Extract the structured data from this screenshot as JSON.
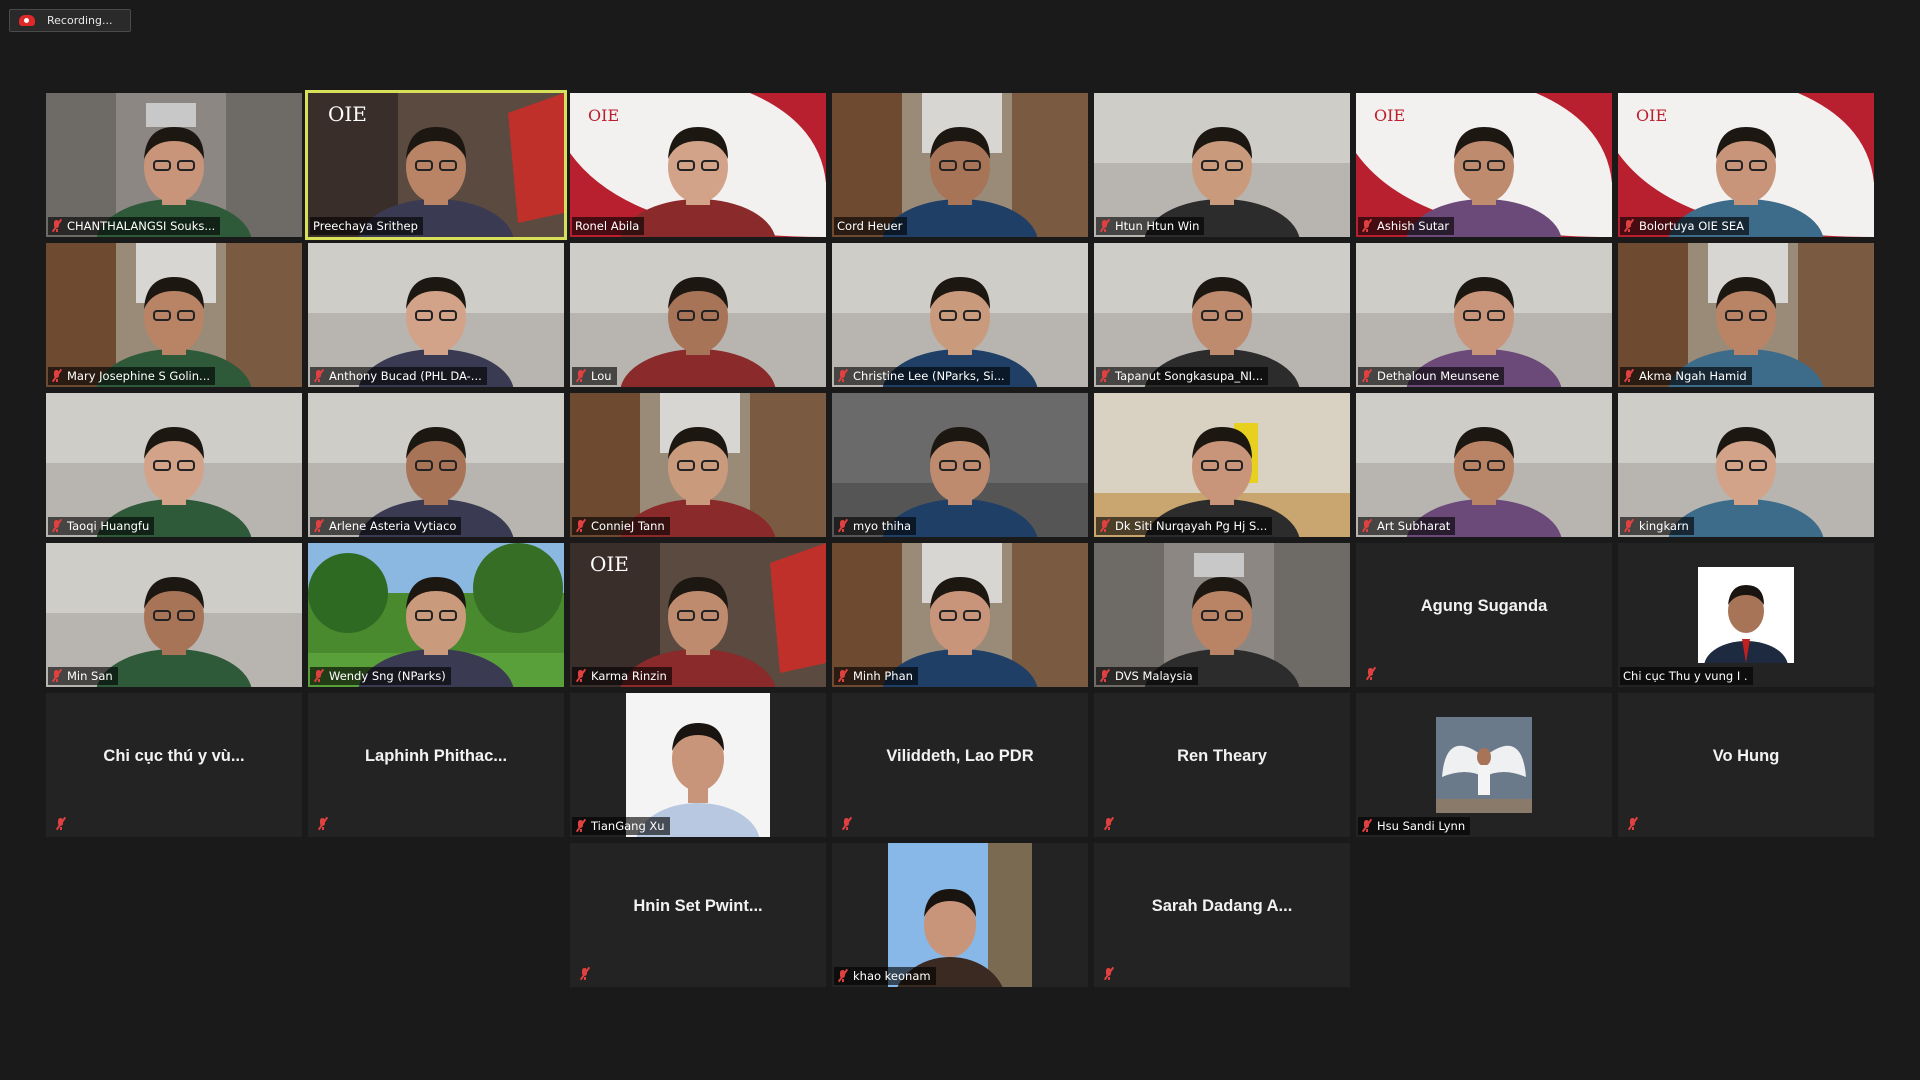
{
  "recording": {
    "label": "Recording..."
  },
  "participants": [
    {
      "name": "CHANTHALANGSI Souks..."
    },
    {
      "name": "Preechaya Srithep"
    },
    {
      "name": "Ronel Abila"
    },
    {
      "name": "Cord Heuer"
    },
    {
      "name": "Htun Htun Win"
    },
    {
      "name": "Ashish Sutar"
    },
    {
      "name": "Bolortuya OIE SEA"
    },
    {
      "name": "Mary Josephine S Golin..."
    },
    {
      "name": "Anthony Bucad (PHL DA-..."
    },
    {
      "name": "Lou"
    },
    {
      "name": "Christine Lee (NParks, Si..."
    },
    {
      "name": "Tapanut Songkasupa_NI..."
    },
    {
      "name": "Dethaloun Meunsene"
    },
    {
      "name": "Akma Ngah Hamid"
    },
    {
      "name": "Taoqi Huangfu"
    },
    {
      "name": "Arlene Asteria Vytiaco"
    },
    {
      "name": "ConnieJ Tann"
    },
    {
      "name": "myo thiha"
    },
    {
      "name": "Dk Siti Nurqayah Pg Hj S..."
    },
    {
      "name": "Art Subharat"
    },
    {
      "name": "kingkarn"
    },
    {
      "name": "Min San"
    },
    {
      "name": "Wendy Sng (NParks)"
    },
    {
      "name": "Karma Rinzin"
    },
    {
      "name": "Minh Phan"
    },
    {
      "name": "DVS Malaysia"
    },
    {
      "name": "Agung Suganda"
    },
    {
      "name": "Chi cục Thu y vung I ."
    },
    {
      "name": "Chi cục thú y vù..."
    },
    {
      "name": "Laphinh  Phithac..."
    },
    {
      "name": "TianGang Xu"
    },
    {
      "name": "Viliddeth, Lao PDR"
    },
    {
      "name": "Ren Theary"
    },
    {
      "name": "Hsu Sandi Lynn"
    },
    {
      "name": "Vo Hung"
    },
    {
      "name": "Hnin Set Pwint..."
    },
    {
      "name": "khao keonam"
    },
    {
      "name": "Sarah Dadang A..."
    }
  ],
  "colors": {
    "background": "#1a1a1a",
    "tile": "#232323",
    "active_speaker_border": "#d8e05a",
    "muted_icon": "#e04040"
  }
}
